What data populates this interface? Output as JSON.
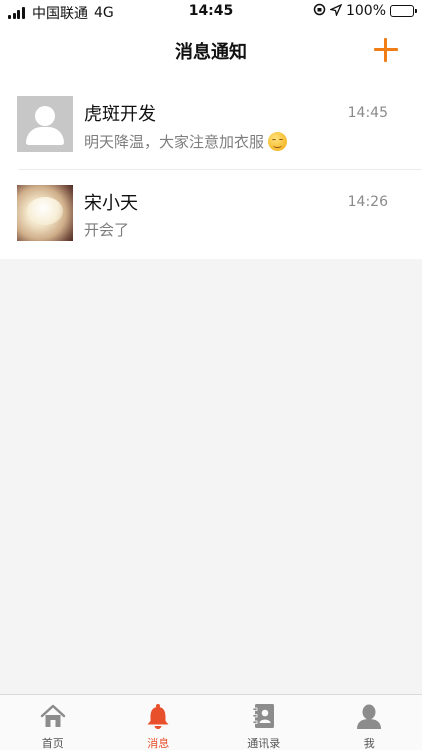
{
  "status_bar": {
    "carrier": "中国联通",
    "network": "4G",
    "time": "14:45",
    "battery": "100%"
  },
  "nav": {
    "title": "消息通知",
    "add_icon": "plus-icon"
  },
  "messages": [
    {
      "name": "虎斑开发",
      "time": "14:45",
      "preview": "明天降温，大家注意加衣服",
      "preview_emoji": "relieved-face-emoji",
      "avatar": "default-user-avatar"
    },
    {
      "name": "宋小天",
      "time": "14:26",
      "preview": "开会了",
      "avatar": "photo-avatar"
    }
  ],
  "tabs": [
    {
      "label": "首页",
      "icon": "home-icon",
      "active": false
    },
    {
      "label": "消息",
      "icon": "bell-icon",
      "active": true
    },
    {
      "label": "通讯录",
      "icon": "contacts-book-icon",
      "active": false
    },
    {
      "label": "我",
      "icon": "user-icon",
      "active": false
    }
  ],
  "colors": {
    "accent": "#f07d16",
    "active_tab": "#e8502b",
    "inactive_tab_icon": "#8c8c8c",
    "battery": "#3cc43c"
  }
}
